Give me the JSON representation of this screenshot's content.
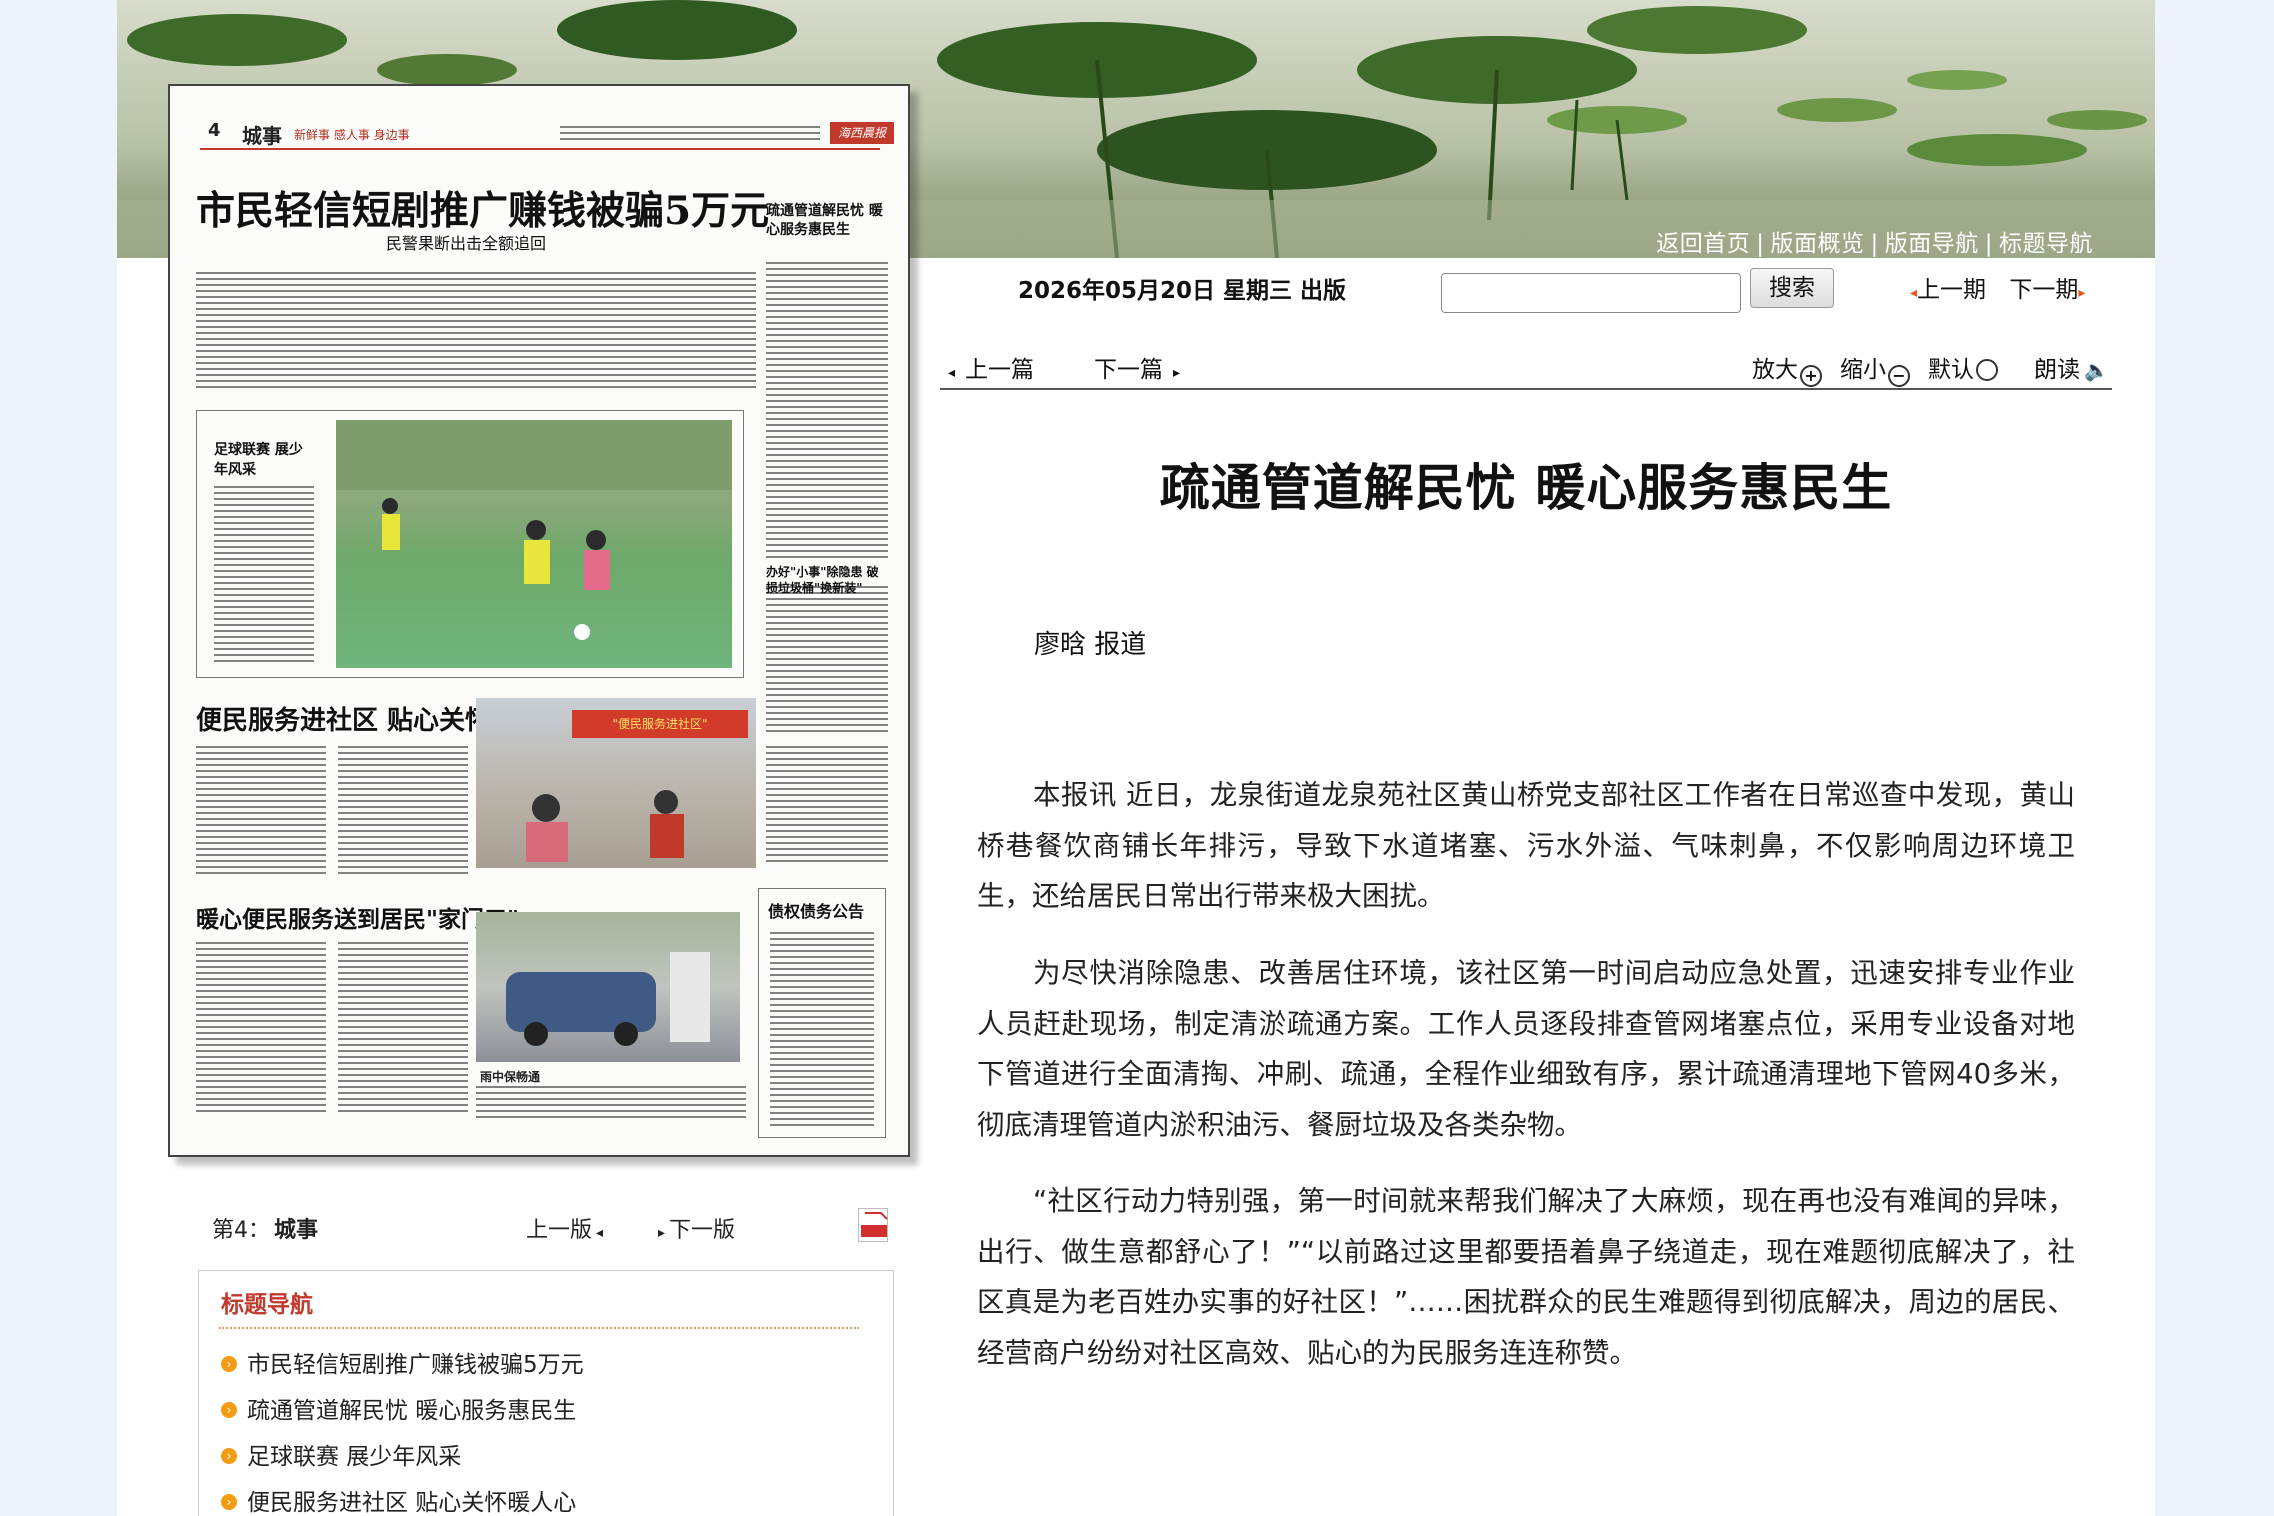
{
  "banner": {
    "nav": [
      "返回首页",
      "版面概览",
      "版面导航",
      "标题导航"
    ]
  },
  "paper": {
    "page_no": "4",
    "section": "城事",
    "slogan": "新鲜事 感人事 身边事",
    "masthead": "海西晨报",
    "lead_headline": "市民轻信短剧推广赚钱被骗5万元",
    "lead_subhead": "民警果断出击全额追回",
    "side_headline": "疏通管道解民忧 暖心服务惠民生",
    "football_title": "足球联赛 展少年风采",
    "right_headline": "办好\"小事\"除隐患 破损垃圾桶\"换新装\"",
    "community_headline": "便民服务进社区 贴心关怀暖人心",
    "banner_slogan": "\"便民服务进社区\"",
    "service_headline": "暖心便民服务送到居民\"家门口\"",
    "notice_title": "债权债务公告",
    "photo_caption": "雨中保畅通"
  },
  "pager": {
    "page_label": "第4：",
    "page_name": "城事",
    "prev": "上一版",
    "next": "下一版",
    "pdf_icon": "pdf-icon"
  },
  "title_nav": {
    "heading": "标题导航",
    "items": [
      "市民轻信短剧推广赚钱被骗5万元",
      "疏通管道解民忧 暖心服务惠民生",
      "足球联赛 展少年风采",
      "便民服务进社区 贴心关怀暖人心"
    ]
  },
  "toolbar": {
    "date": "2026年05月20日 星期三 出版",
    "search_value": "",
    "search_label": "搜索",
    "prev_issue": "上一期",
    "next_issue": "下一期"
  },
  "article_nav": {
    "prev": "上一篇",
    "next": "下一篇",
    "zoom_in": "放大",
    "zoom_out": "缩小",
    "default": "默认",
    "read": "朗读"
  },
  "article": {
    "title": "疏通管道解民忧 暖心服务惠民生",
    "author": "廖晗 报道",
    "paragraphs": [
      "本报讯 近日，龙泉街道龙泉苑社区黄山桥党支部社区工作者在日常巡查中发现，黄山桥巷餐饮商铺长年排污，导致下水道堵塞、污水外溢、气味刺鼻，不仅影响周边环境卫生，还给居民日常出行带来极大困扰。",
      "为尽快消除隐患、改善居住环境，该社区第一时间启动应急处置，迅速安排专业作业人员赶赴现场，制定清淤疏通方案。工作人员逐段排查管网堵塞点位，采用专业设备对地下管道进行全面清掏、冲刷、疏通，全程作业细致有序，累计疏通清理地下管网40多米，彻底清理管道内淤积油污、餐厨垃圾及各类杂物。",
      "“社区行动力特别强，第一时间就来帮我们解决了大麻烦，现在再也没有难闻的异味，出行、做生意都舒心了！”“以前路过这里都要捂着鼻子绕道走，现在难题彻底解决了，社区真是为老百姓办实事的好社区！”……困扰群众的民生难题得到彻底解决，周边的居民、经营商户纷纷对社区高效、贴心的为民服务连连称赞。"
    ]
  }
}
